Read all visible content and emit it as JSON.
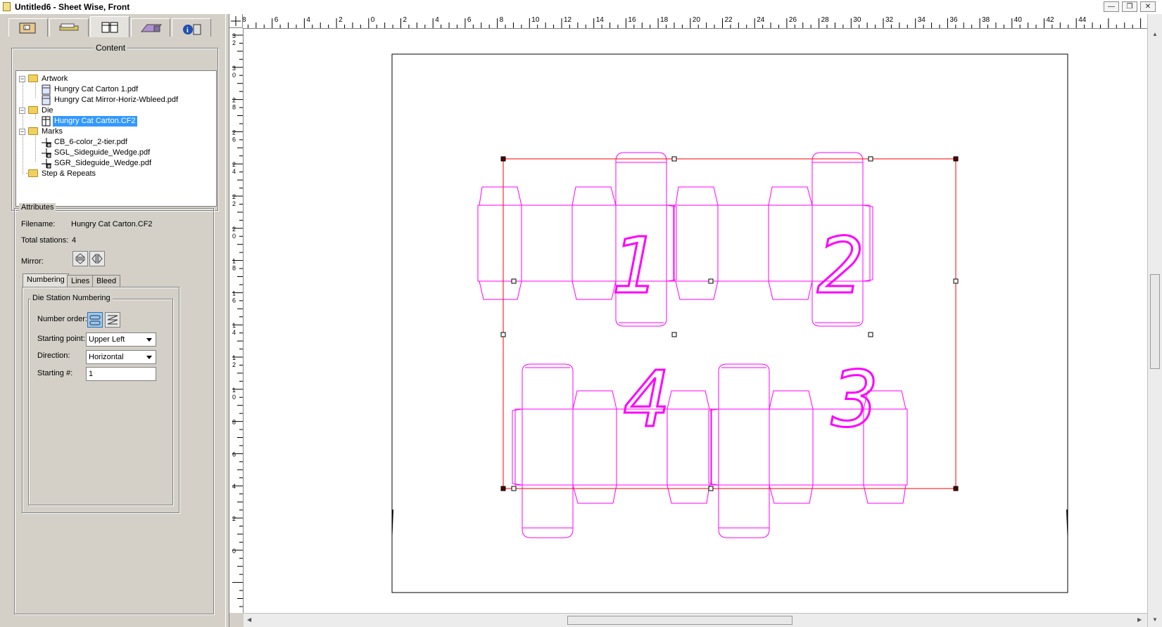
{
  "window": {
    "title": "Untitled6 - Sheet Wise, Front",
    "minimize_label": "—",
    "restore_label": "❐",
    "close_label": "✕"
  },
  "panel_tabs": [
    {
      "name": "job",
      "icon": "job-info-icon"
    },
    {
      "name": "layout",
      "icon": "plates-icon"
    },
    {
      "name": "content",
      "icon": "carton-icon"
    },
    {
      "name": "press",
      "icon": "press-icon"
    },
    {
      "name": "info",
      "icon": "info-icon"
    }
  ],
  "content": {
    "legend": "Content",
    "tree": [
      {
        "label": "Artwork",
        "type": "folder",
        "expander": "−"
      },
      {
        "label": "Hungry Cat Carton 1.pdf",
        "type": "pdf"
      },
      {
        "label": "Hungry Cat Mirror-Horiz-Wbleed.pdf",
        "type": "pdf"
      },
      {
        "label": "Die",
        "type": "folder",
        "expander": "−"
      },
      {
        "label": "Hungry Cat Carton.CF2",
        "type": "die",
        "selected": true
      },
      {
        "label": "Marks",
        "type": "folder",
        "expander": "−"
      },
      {
        "label": "CB_6-color_2-tier.pdf",
        "type": "mark"
      },
      {
        "label": "SGL_Sideguide_Wedge.pdf",
        "type": "mark"
      },
      {
        "label": "SGR_Sideguide_Wedge.pdf",
        "type": "mark"
      },
      {
        "label": "Step & Repeats",
        "type": "folder"
      }
    ]
  },
  "attributes": {
    "legend": "Attributes",
    "filename_label": "Filename:",
    "filename_value": "Hungry Cat Carton.CF2",
    "stations_label": "Total stations:",
    "stations_value": "4",
    "mirror_label": "Mirror:",
    "tabs": [
      "Numbering",
      "Lines",
      "Bleed"
    ],
    "active_tab": "Numbering",
    "numbering": {
      "legend": "Die Station Numbering",
      "order_label": "Number order:",
      "start_label": "Starting point:",
      "start_value": "Upper Left",
      "direction_label": "Direction:",
      "direction_value": "Horizontal",
      "start_num_label": "Starting #:",
      "start_num_value": "1"
    }
  },
  "ruler": {
    "h_labels": [
      "8",
      "6",
      "4",
      "2",
      "0",
      "2",
      "4",
      "6",
      "8",
      "10",
      "12",
      "14",
      "16",
      "18",
      "20",
      "22",
      "24",
      "26",
      "28",
      "30",
      "32",
      "34",
      "36",
      "38",
      "40",
      "42",
      "44"
    ],
    "v_labels": [
      "32",
      "30",
      "28",
      "26",
      "24",
      "22",
      "20",
      "18",
      "16",
      "14",
      "12",
      "10",
      "8",
      "6",
      "4",
      "2",
      "0"
    ]
  },
  "stations": [
    "1",
    "2",
    "3",
    "4"
  ],
  "colors": {
    "die_line": "#ff00ff",
    "selection": "#ff0000",
    "tree_selection": "#3399ff"
  }
}
